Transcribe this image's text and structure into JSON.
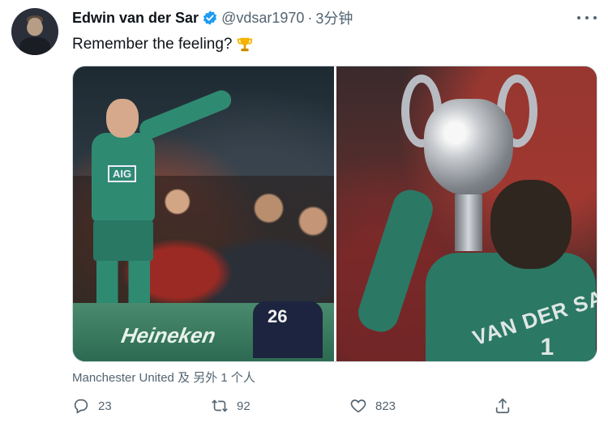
{
  "author": {
    "name": "Edwin van der Sar",
    "handle": "@vdsar1970",
    "separator": "·",
    "time": "3分钟",
    "verified_color": "#1d9bf0"
  },
  "tweet": {
    "text": "Remember the feeling?",
    "emoji": "trophy-icon"
  },
  "media": {
    "left_photo": {
      "sponsor_shirt": "AIG",
      "board_text": "Heineken",
      "player_number": "26"
    },
    "right_photo": {
      "shirt_name": "VAN DER SA",
      "shirt_number": "1"
    }
  },
  "attribution": "Manchester United 及 另外 1 个人",
  "actions": {
    "reply_count": "23",
    "retweet_count": "92",
    "like_count": "823"
  }
}
